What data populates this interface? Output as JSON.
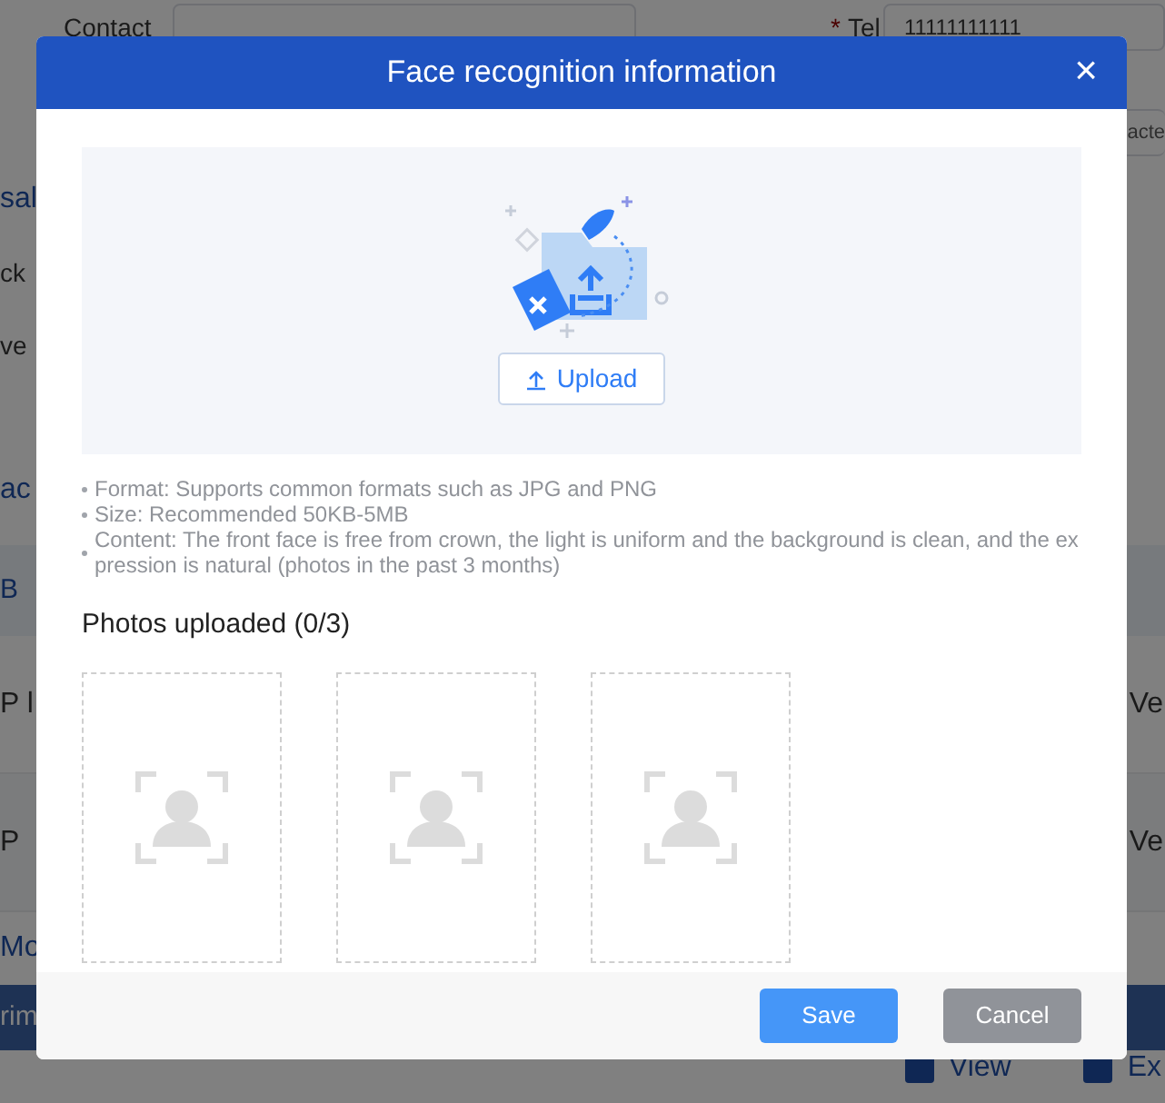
{
  "background": {
    "contact_label": "Contact",
    "required_mark": "*",
    "tel_label": "Tel",
    "tel_value": "11111111111",
    "second_field_placeholder": "acte",
    "rows": [
      {
        "kind": "title",
        "left": "sal"
      },
      {
        "kind": "text",
        "left": "ck"
      },
      {
        "kind": "text",
        "left": "ve"
      },
      {
        "kind": "title",
        "left": "ac"
      },
      {
        "kind": "table_head",
        "left": "B"
      },
      {
        "kind": "table_row",
        "left": "P l",
        "right": "Ve"
      },
      {
        "kind": "table_row",
        "left": "P",
        "right": "Ve"
      },
      {
        "kind": "title",
        "left": "Mo"
      },
      {
        "kind": "header_bar",
        "left": "rim"
      }
    ],
    "checkboxes": [
      {
        "label": "View",
        "checked": true
      },
      {
        "label": "Ex",
        "checked": true
      }
    ]
  },
  "modal": {
    "title": "Face recognition information",
    "close": "×",
    "upload_button": "Upload",
    "notes": [
      "Format: Supports common formats such as JPG and PNG",
      "Size: Recommended 50KB-5MB",
      "Content: The front face is free from crown, the light is uniform and the background is clean, and the ex pression is natural (photos in the past 3 months)"
    ],
    "photos_heading": "Photos uploaded (0/3)",
    "photo_slots": [
      {
        "kind": "empty"
      },
      {
        "kind": "empty"
      },
      {
        "kind": "empty"
      }
    ],
    "buttons": [
      {
        "kind": "primary",
        "label": "Save"
      },
      {
        "kind": "secondary",
        "label": "Cancel"
      }
    ]
  }
}
